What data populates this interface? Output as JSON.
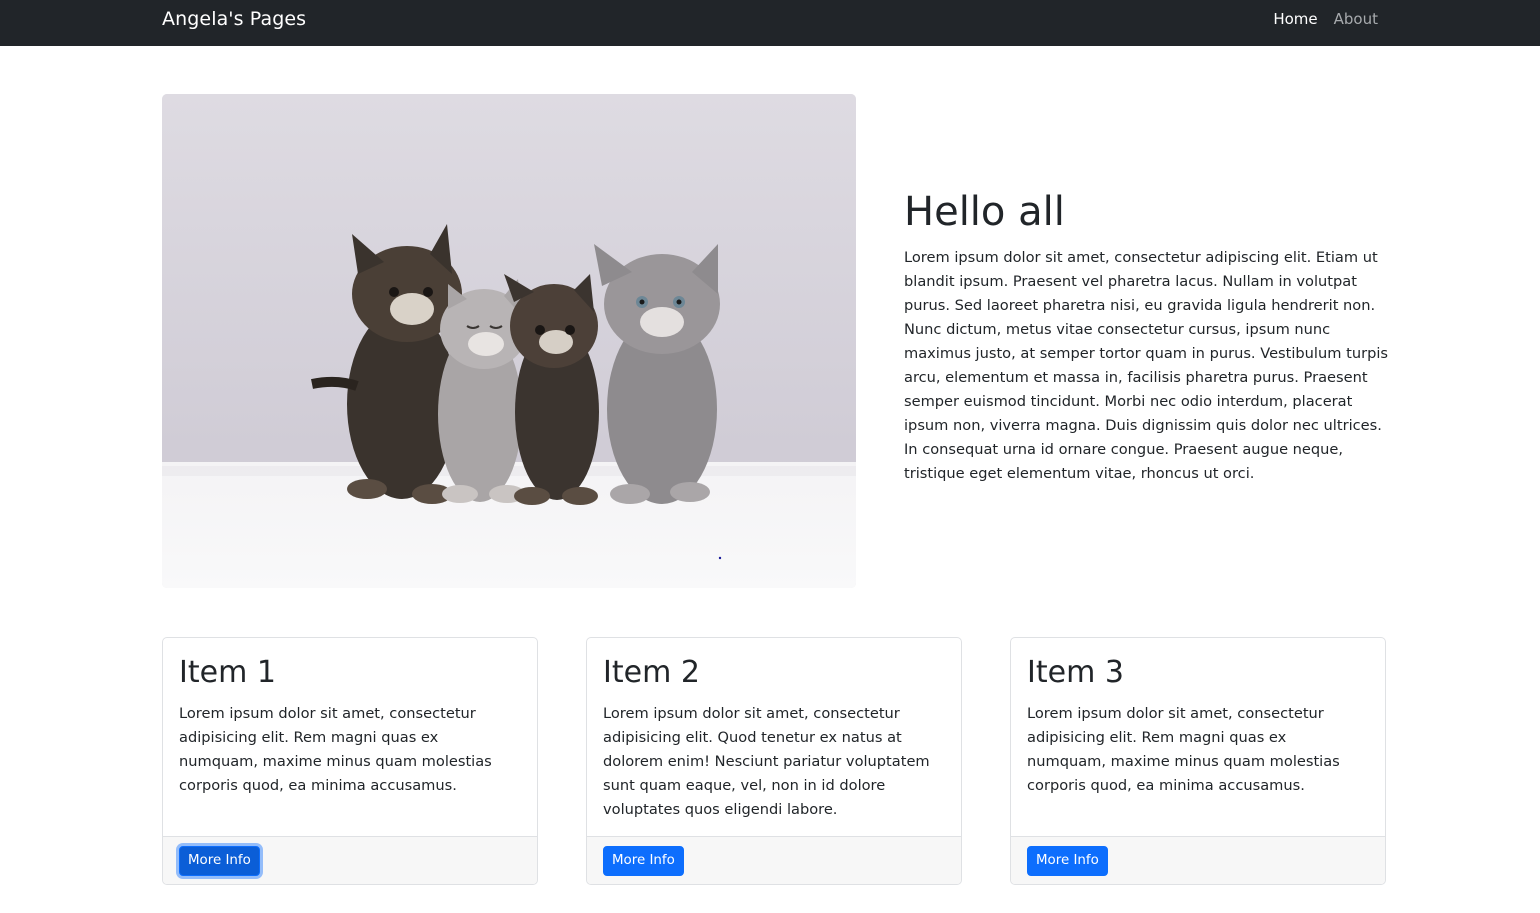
{
  "navbar": {
    "brand": "Angela's Pages",
    "links": [
      {
        "label": "Home",
        "active": true
      },
      {
        "label": "About",
        "active": false
      }
    ]
  },
  "hero": {
    "image_subject": "four kittens sitting",
    "title": "Hello all",
    "body": "Lorem ipsum dolor sit amet, consectetur adipiscing elit. Etiam ut blandit ipsum. Praesent vel pharetra lacus. Nullam in volutpat purus. Sed laoreet pharetra nisi, eu gravida ligula hendrerit non. Nunc dictum, metus vitae consectetur cursus, ipsum nunc maximus justo, at semper tortor quam in purus. Vestibulum turpis arcu, elementum et massa in, facilisis pharetra purus. Praesent semper euismod tincidunt. Morbi nec odio interdum, placerat ipsum non, viverra magna. Duis dignissim quis dolor nec ultrices. In consequat urna id ornare congue. Praesent augue neque, tristique eget elementum vitae, rhoncus ut orci."
  },
  "cards": [
    {
      "title": "Item 1",
      "text": "Lorem ipsum dolor sit amet, consectetur adipisicing elit. Rem magni quas ex numquam, maxime minus quam molestias corporis quod, ea minima accusamus.",
      "button": "More Info"
    },
    {
      "title": "Item 2",
      "text": "Lorem ipsum dolor sit amet, consectetur adipisicing elit. Quod tenetur ex natus at dolorem enim! Nesciunt pariatur voluptatem sunt quam eaque, vel, non in id dolore voluptates quos eligendi labore.",
      "button": "More Info"
    },
    {
      "title": "Item 3",
      "text": "Lorem ipsum dolor sit amet, consectetur adipisicing elit. Rem magni quas ex numquam, maxime minus quam molestias corporis quod, ea minima accusamus.",
      "button": "More Info"
    }
  ],
  "colors": {
    "navbar_bg": "#212529",
    "primary_button": "#0d6efd",
    "card_footer_bg": "#f7f7f7"
  }
}
